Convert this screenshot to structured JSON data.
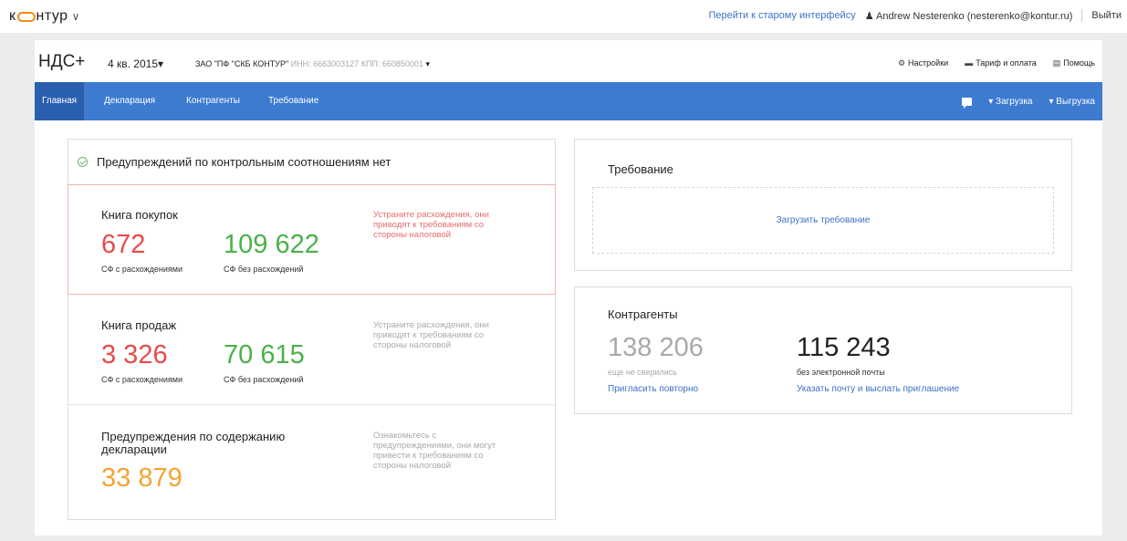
{
  "topbar": {
    "logo_pre": "к",
    "logo_post": "нтур",
    "logo_chevron": "∨",
    "old_interface_link": "Перейти к старому интерфейсу",
    "user": "Andrew Nesterenko (nesterenko@kontur.ru)",
    "logout": "Выйти"
  },
  "header": {
    "product": "НДС+",
    "period": "4 кв. 2015",
    "org_name": "ЗАО \"ПФ \"СКБ КОНТУР\"",
    "org_ids": "ИНН: 6663003127 КПП: 660850001",
    "settings": "Настройки",
    "tariff": "Тариф и оплата",
    "help": "Помощь"
  },
  "nav": {
    "tabs": [
      "Главная",
      "Декларация",
      "Контрагенты",
      "Требование"
    ],
    "upload": "Загрузка",
    "download": "Выгрузка"
  },
  "status": {
    "headline": "Предупреждений по контрольным соотношениям нет"
  },
  "purchase_book": {
    "title": "Книга покупок",
    "with_discrepancies": "672",
    "with_discrepancies_caption": "СФ с расхождениями",
    "without_discrepancies": "109 622",
    "without_discrepancies_caption": "СФ без расхождений",
    "note": "Устраните расхождения, они приводят к требованиям со стороны налоговой"
  },
  "sales_book": {
    "title": "Книга продаж",
    "with_discrepancies": "3 326",
    "with_discrepancies_caption": "СФ с расхождениями",
    "without_discrepancies": "70 615",
    "without_discrepancies_caption": "СФ без расхождений",
    "note": "Устраните расхождения, они приводят к требованиям со стороны налоговой"
  },
  "content_warnings": {
    "title": "Предупреждения по содержанию декларации",
    "count": "33 879",
    "note": "Ознакомьтесь с предупреждениями, они могут привести к требованиям со стороны налоговой"
  },
  "requirement": {
    "title": "Требование",
    "upload_link": "Загрузить требование"
  },
  "counterparties": {
    "title": "Контрагенты",
    "not_reconciled": "138 206",
    "not_reconciled_caption": "еще не сверились",
    "invite_again": "Пригласить повторно",
    "no_email": "115 243",
    "no_email_caption": "без электронной почты",
    "set_email": "Указать почту и выслать приглашение"
  },
  "colors": {
    "nav_blue": "#3d7bd1",
    "nav_active": "#2a5fae",
    "red": "#e94a4a",
    "green": "#4bb04b",
    "orange": "#f3a431",
    "link": "#3a73c4",
    "logo_ring": "#f28a1a"
  }
}
